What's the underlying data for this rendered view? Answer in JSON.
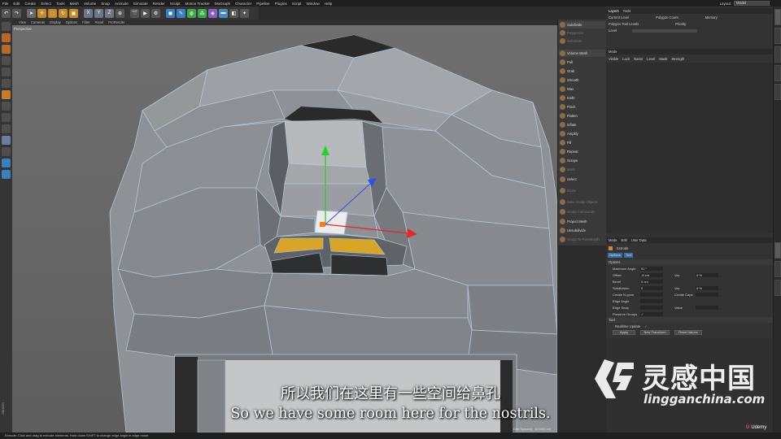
{
  "menu": [
    "File",
    "Edit",
    "Create",
    "Select",
    "Tools",
    "Mesh",
    "Volume",
    "Snap",
    "Animate",
    "Simulate",
    "Render",
    "Sculpt",
    "Motion Tracker",
    "MoGraph",
    "Character",
    "Pipeline",
    "Plugins",
    "Script",
    "Window",
    "Help"
  ],
  "layout": {
    "label": "Layout:",
    "value": "Model"
  },
  "viewport": {
    "menu": [
      "View",
      "Cameras",
      "Display",
      "Options",
      "Filter",
      "Panel",
      "ProRender"
    ],
    "label": "Perspective",
    "grid_info": "Grid Spacing : 100000 cm"
  },
  "palette": {
    "items": [
      {
        "label": "Subdivide",
        "dim": false,
        "hdr": true
      },
      {
        "label": "Polygonize",
        "dim": true
      },
      {
        "label": "Subdivide",
        "dim": true
      },
      {
        "label": "Volume Mesh",
        "dim": false,
        "hdr": true
      },
      {
        "label": "Pull",
        "dim": false
      },
      {
        "label": "Grab",
        "dim": false
      },
      {
        "label": "Smooth",
        "dim": false
      },
      {
        "label": "Wax",
        "dim": false
      },
      {
        "label": "Knife",
        "dim": false
      },
      {
        "label": "Pinch",
        "dim": false
      },
      {
        "label": "Flatten",
        "dim": false
      },
      {
        "label": "Inflate",
        "dim": false
      },
      {
        "label": "Amplify",
        "dim": false
      },
      {
        "label": "Fill",
        "dim": false
      },
      {
        "label": "Repeat",
        "dim": false
      },
      {
        "label": "Scrape",
        "dim": false
      },
      {
        "label": "Mask",
        "dim": true
      },
      {
        "label": "Select",
        "dim": false
      },
      {
        "label": "Erase",
        "dim": true
      },
      {
        "label": "Bake Sculpt Objects",
        "dim": true
      },
      {
        "label": "Sculpt Commands",
        "dim": true
      },
      {
        "label": "Project Mesh",
        "dim": false
      },
      {
        "label": "Unsubdivide",
        "dim": false
      },
      {
        "label": "Sculpt To PoseMorph",
        "dim": true
      }
    ]
  },
  "layers_panel": {
    "tabs": [
      "Layers",
      "Tools"
    ],
    "row1": [
      "Current Level",
      "Polygon Count",
      "Memory"
    ],
    "row2": [
      "Polygon Tool Levels",
      "Priority"
    ],
    "level_label": "Level",
    "mode_label": "Mode",
    "columns": [
      "Visible",
      "Lock",
      "Name",
      "Level",
      "Mask",
      "Strength"
    ]
  },
  "attributes": {
    "menu": [
      "Mode",
      "Edit",
      "User Data"
    ],
    "tool_name": "Extrude",
    "tabs": [
      "Options",
      "Tool"
    ],
    "section_options": "Options",
    "fields": [
      {
        "k": "Maximum Angle",
        "v": "91 °"
      },
      {
        "k": "Offset",
        "v": "-8 cm"
      },
      {
        "k": "Bevel",
        "v": "0 cm"
      },
      {
        "k": "Subdivision",
        "v": "0"
      },
      {
        "k": "Create N-gons",
        "v": ""
      },
      {
        "k": "Edge Angle",
        "v": ""
      },
      {
        "k": "Edge Snap",
        "v": ""
      },
      {
        "k": "Preserve Groups",
        "v": "✓"
      }
    ],
    "fields_right": [
      {
        "k": "Var.",
        "v": "0 %"
      },
      {
        "k": "Var.",
        "v": "0 %"
      },
      {
        "k": "Create Caps",
        "v": ""
      },
      {
        "k": "Value",
        "v": ""
      }
    ],
    "section_tool": "Tool",
    "realtime": "Realtime Update",
    "buttons": [
      "Apply",
      "New Transform",
      "Reset Values"
    ]
  },
  "subtitle": {
    "cn": "所以我们在这里有一些空间给鼻孔",
    "en": "So we have some room here for the nostrils."
  },
  "watermark": {
    "cn": "灵感中国",
    "url": "lingganchina.com"
  },
  "udemy": "Udemy",
  "maxon": "MAXON",
  "status": "Extrude: Click and drag to extrude elements. Hold down SHIFT to change edge angle in edge mode"
}
